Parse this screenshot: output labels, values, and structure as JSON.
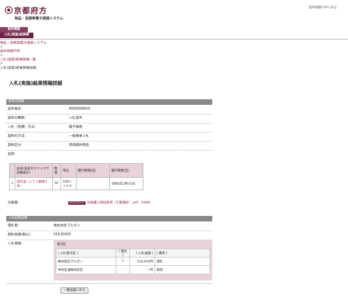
{
  "header": {
    "logo_text": "京都府方",
    "system_title": "物品・役務等電子調達システム",
    "top_link": "案件情報TOPへ戻る"
  },
  "tabs": [
    "案件情報",
    "入札(実施)結果情報"
  ],
  "breadcrumb": {
    "items": [
      "物品・役務等電子調達システム",
      "案件情報TOP",
      "入札(実施)結果情報一覧"
    ],
    "separator": ">",
    "current": "入札(実施)結果情報詳細"
  },
  "page_title": "入札(実施)結果情報詳細",
  "case_section": {
    "title": "案件の詳細",
    "rows": [
      {
        "label": "案件番号：",
        "value": "4000058929"
      },
      {
        "label": "案件の種類：",
        "value": "入札案件"
      },
      {
        "label": "入札（見積）方法：",
        "value": "電子調達"
      },
      {
        "label": "契約の方法：",
        "value": "一般競争入札"
      },
      {
        "label": "契約区分：",
        "value": "単価契約用品"
      },
      {
        "label": "品目：",
        "value": ""
      }
    ]
  },
  "items_table": {
    "headers": [
      "",
      "品名(品名をクリックで詳細表示)",
      "数量",
      "単位",
      "履行期間(自)",
      "履行期間(至)"
    ],
    "rows": [
      {
        "no": "1",
        "name": "白灯油（ＪＩＳ規格１号）",
        "qty": "50",
        "unit": "100リットル",
        "from": "",
        "to": "令和4年3月31日"
      }
    ]
  },
  "spec": {
    "label": "仕様書：",
    "badge": "ダウンロード",
    "file": "仕様書(j 特記事項（工業兼好）.pdf：44KB）"
  },
  "result_section": {
    "title": "入札結果詳細",
    "winner_label": "落札者：",
    "winner": "株式会社マルゼン",
    "amount_label": "契約金額(税込)：",
    "amount": "516,650円",
    "info_label": "入札情報：",
    "round": "第1回",
    "table_headers": [
      "[ 入札者氏名 ]",
      "[ 順位 ]",
      "[ 入札金額 ]",
      "[ 備考 ]"
    ],
    "table_rows": [
      {
        "name": "株式会社マルゼン",
        "rank": "1",
        "bid": "516,650円",
        "note": "落札"
      },
      {
        "name": "中村石油株式会社",
        "rank": "-",
        "bid": "---円",
        "note": "辞退"
      }
    ]
  },
  "back_button": "一覧画面に戻る",
  "colors": {
    "accent": "#8a3c5e",
    "section": "#888888",
    "panel": "#e8d2dc"
  }
}
